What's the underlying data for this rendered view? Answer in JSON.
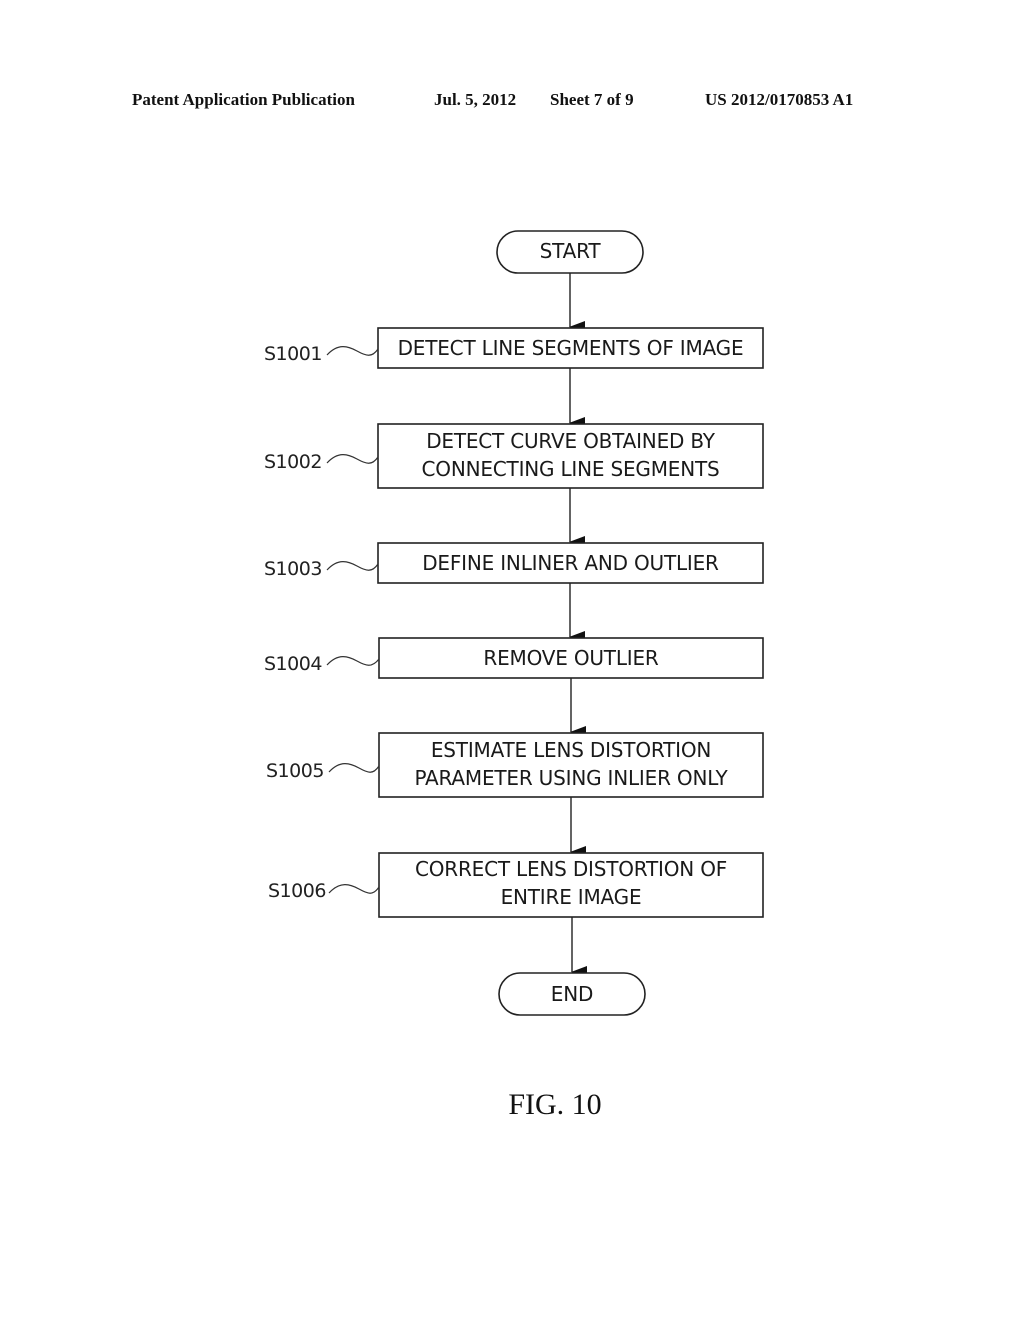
{
  "header": {
    "publication": "Patent Application Publication",
    "date": "Jul. 5, 2012",
    "sheet": "Sheet 7 of 9",
    "patent_number": "US 2012/0170853 A1"
  },
  "flowchart": {
    "start": "START",
    "end": "END",
    "steps": [
      {
        "id": "S1001",
        "line1": "DETECT LINE SEGMENTS OF IMAGE",
        "line2": ""
      },
      {
        "id": "S1002",
        "line1": "DETECT CURVE OBTAINED BY",
        "line2": "CONNECTING LINE SEGMENTS"
      },
      {
        "id": "S1003",
        "line1": "DEFINE INLINER AND OUTLIER",
        "line2": ""
      },
      {
        "id": "S1004",
        "line1": "REMOVE OUTLIER",
        "line2": ""
      },
      {
        "id": "S1005",
        "line1": "ESTIMATE LENS DISTORTION",
        "line2": "PARAMETER USING INLIER ONLY"
      },
      {
        "id": "S1006",
        "line1": "CORRECT LENS DISTORTION OF",
        "line2": "ENTIRE IMAGE"
      }
    ]
  },
  "figure_label": "FIG. 10"
}
